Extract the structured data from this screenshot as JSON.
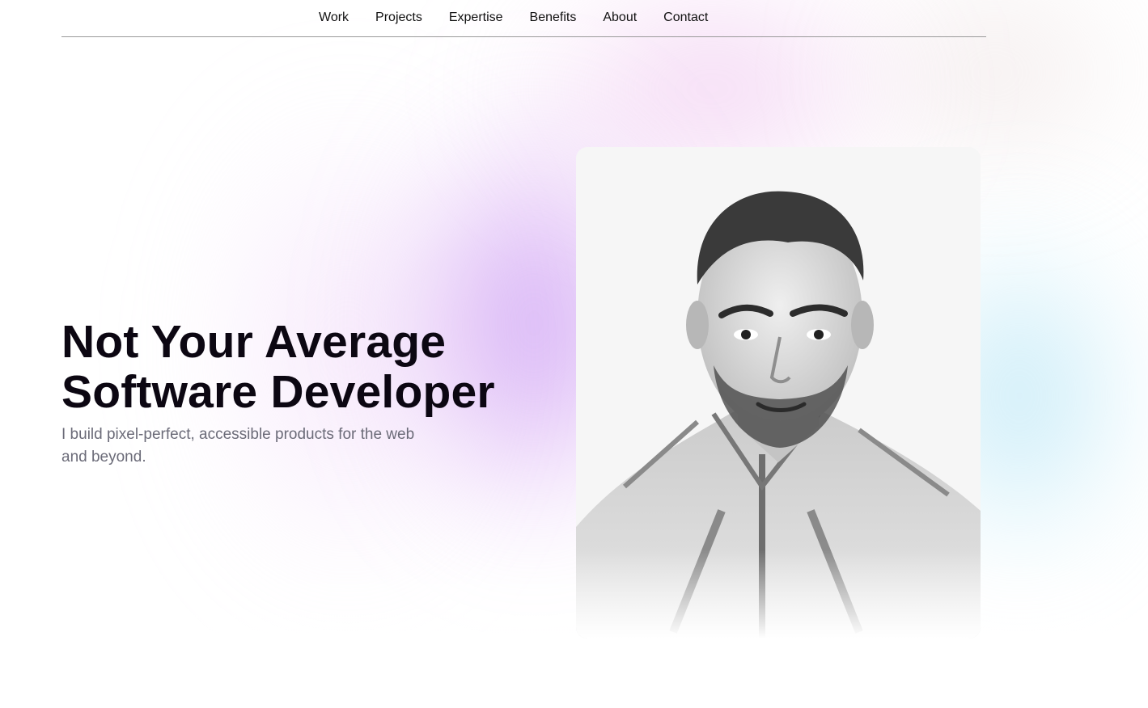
{
  "nav": {
    "items": [
      {
        "label": "Work"
      },
      {
        "label": "Projects"
      },
      {
        "label": "Expertise"
      },
      {
        "label": "Benefits"
      },
      {
        "label": "About"
      },
      {
        "label": "Contact"
      }
    ]
  },
  "hero": {
    "title_line1": "Not Your Average",
    "title_line2": "Software Developer",
    "subtitle": "I build pixel-perfect, accessible products for the web and beyond."
  },
  "portrait": {
    "icon": "person-portrait-photo"
  },
  "colors": {
    "title": "#0c0712",
    "subtitle": "#6b6b78",
    "glow_purple": "#b478f0",
    "glow_pink": "#e196e1",
    "glow_cyan": "#96d7f0"
  }
}
